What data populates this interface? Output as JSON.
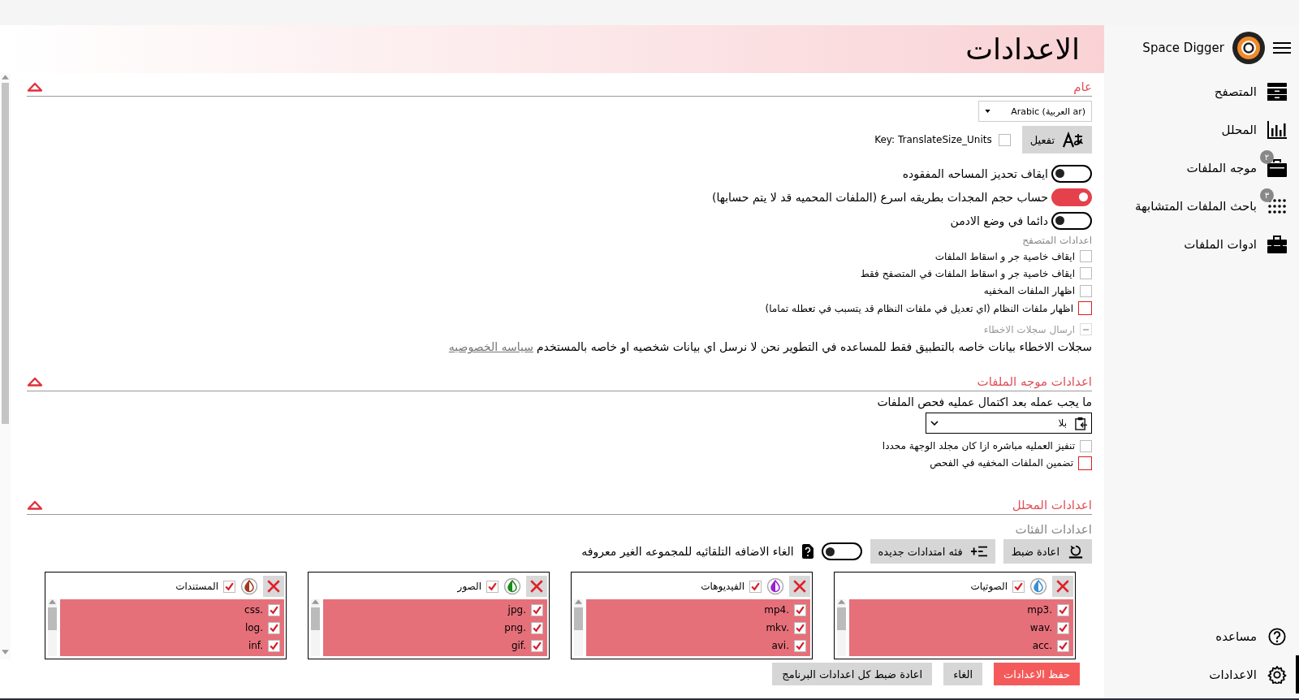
{
  "sidebar": {
    "app_name": "Space Digger",
    "items": [
      {
        "label": "المتصفح",
        "selected": false
      },
      {
        "label": "المحلل",
        "selected": false
      },
      {
        "label": "موجه الملفات",
        "selected": false,
        "badge": "٢"
      },
      {
        "label": "باحث الملفات المتشابهة",
        "selected": false,
        "badge": "٣"
      },
      {
        "label": "ادوات الملفات",
        "selected": false
      }
    ],
    "bottom_items": [
      {
        "label": "مساعده",
        "selected": false
      },
      {
        "label": "الاعدادات",
        "selected": true
      }
    ]
  },
  "page_title": "الاعدادات",
  "general": {
    "title": "عام",
    "expanded": true,
    "language": "Arabic (العربية ar)",
    "translate_button": "تفعيل",
    "translate_key": {
      "label": "Key: TranslateSize_Units",
      "checked": false
    },
    "toggles": [
      {
        "label": "ايقاف تحديز المساحه المفقوده",
        "on": false
      },
      {
        "label": "حساب حجم المجدات بطريقه اسرع (الملفات المحميه قد لا يتم حسابها)",
        "on": true
      },
      {
        "label": "دائما في وضع الادمن",
        "on": false
      }
    ],
    "browser_heading": "اعدادات المتصفح",
    "checkboxes": [
      {
        "label": "ايقاف خاصية جر و اسقاط الملفات",
        "checked": false,
        "warning": false
      },
      {
        "label": "ايقاف خاصية جر و اسقاط الملفات في المتصفح فقط",
        "checked": false,
        "warning": false
      },
      {
        "label": "اظهار الملفات المخفيه",
        "checked": false,
        "warning": false
      },
      {
        "label": "اظهار ملفات النظام (اي تعديل في ملفات النظام قد يتسبب في تعطله تماما)",
        "checked": false,
        "warning": true
      }
    ],
    "error_logs": {
      "label": "ارسال سجلات الاخطاء",
      "disabled": true
    },
    "privacy_note": "سجلات الاخطاء بيانات خاصه بالتطبيق فقط للمساعده في التطوير نحن لا نرسل اي بيانات شخصيه او خاصه بالمستخدم",
    "privacy_link": "سياسه الخصوصيه"
  },
  "file_director": {
    "title": "اعدادات موجه الملفات",
    "expanded": true,
    "after_scan_label": "ما يجب عمله بعد اكتمال عمليه فحص الملفات",
    "after_scan_value": "بلا",
    "checkboxes": [
      {
        "label": "تنفيز العمليه مباشره ازا كان مجلد الوجهة محددا",
        "checked": false,
        "warning": false
      },
      {
        "label": "تضمين الملفات المخفيه في الفحص",
        "checked": false,
        "warning": true
      }
    ]
  },
  "analyzer": {
    "title": "اعدادات المحلل",
    "expanded": true,
    "categories_heading": "اعدادات الفئات",
    "reset_button": "اعادة ضبط",
    "new_category_button": "فئه امتدادات جديده",
    "auto_add": {
      "label": "الغاء الاضافه التلقائيه للمجموعه الغير معروفه",
      "on": false
    },
    "categories": [
      {
        "name": "الصوتيات",
        "color": "#3a8fd0",
        "checked": true,
        "extensions": [
          {
            "ext": "mp3.",
            "checked": true
          },
          {
            "ext": "wav.",
            "checked": true
          },
          {
            "ext": "acc.",
            "checked": true
          }
        ]
      },
      {
        "name": "الفيديوهات",
        "color": "#9b1fd0",
        "checked": true,
        "extensions": [
          {
            "ext": "mp4.",
            "checked": true
          },
          {
            "ext": "mkv.",
            "checked": true
          },
          {
            "ext": "avi.",
            "checked": true
          }
        ]
      },
      {
        "name": "الصور",
        "color": "#1a8a1a",
        "checked": true,
        "extensions": [
          {
            "ext": "jpg.",
            "checked": true
          },
          {
            "ext": "png.",
            "checked": true
          },
          {
            "ext": "gif.",
            "checked": true
          }
        ]
      },
      {
        "name": "المستندات",
        "color": "#a0391f",
        "checked": true,
        "extensions": [
          {
            "ext": "css.",
            "checked": true
          },
          {
            "ext": "log.",
            "checked": true
          },
          {
            "ext": "inf.",
            "checked": true
          }
        ]
      }
    ]
  },
  "footer_buttons": [
    {
      "label": "حفظ الاعدادات",
      "kind": "primary"
    },
    {
      "label": "الغاء",
      "kind": "secondary"
    },
    {
      "label": "اعادة ضبط كل اعدادات البرنامج",
      "kind": "secondary"
    }
  ]
}
